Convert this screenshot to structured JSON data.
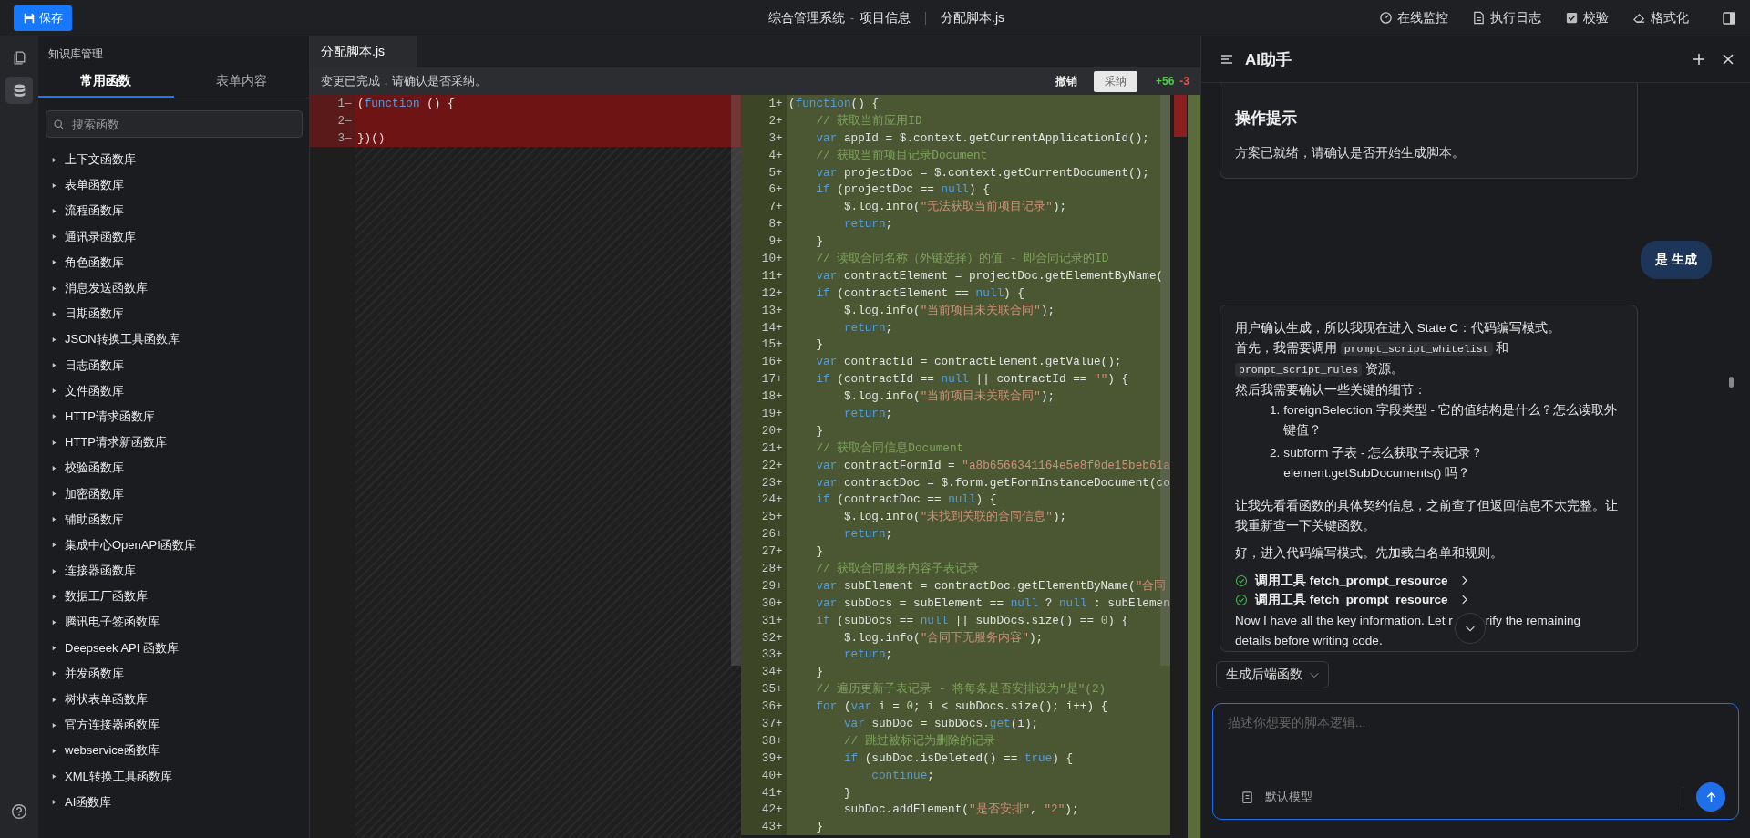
{
  "toolbar": {
    "save_button": "保存",
    "app": "综合管理系统",
    "separator": "-",
    "page": "项目信息",
    "file": "分配脚本.js",
    "actions": [
      {
        "label": "在线监控"
      },
      {
        "label": "执行日志"
      },
      {
        "label": "校验"
      },
      {
        "label": "格式化"
      }
    ]
  },
  "rail": [
    {
      "selected": false
    },
    {
      "selected": true
    }
  ],
  "sidebar": {
    "title": "知识库管理",
    "tabs": [
      {
        "label": "常用函数",
        "selected": true
      },
      {
        "label": "表单内容",
        "selected": false
      }
    ],
    "search": {
      "placeholder": "搜索函数"
    },
    "libraries": [
      {
        "label": "上下文函数库",
        "expanded": false
      },
      {
        "label": "表单函数库",
        "expanded": false
      },
      {
        "label": "流程函数库",
        "expanded": false
      },
      {
        "label": "通讯录函数库",
        "expanded": false
      },
      {
        "label": "角色函数库",
        "expanded": false
      },
      {
        "label": "消息发送函数库",
        "expanded": false
      },
      {
        "label": "日期函数库",
        "expanded": false
      },
      {
        "label": "JSON转换工具函数库",
        "expanded": false
      },
      {
        "label": "日志函数库",
        "expanded": false
      },
      {
        "label": "文件函数库",
        "expanded": false
      },
      {
        "label": "HTTP请求函数库",
        "expanded": false
      },
      {
        "label": "HTTP请求新函数库",
        "expanded": false
      },
      {
        "label": "校验函数库",
        "expanded": false
      },
      {
        "label": "加密函数库",
        "expanded": false
      },
      {
        "label": "辅助函数库",
        "expanded": false
      },
      {
        "label": "集成中心OpenAPI函数库",
        "expanded": false
      },
      {
        "label": "连接器函数库",
        "expanded": false
      },
      {
        "label": "数据工厂函数库",
        "expanded": false
      },
      {
        "label": "腾讯电子签函数库",
        "expanded": false
      },
      {
        "label": "Deepseek API 函数库",
        "expanded": false
      },
      {
        "label": "并发函数库",
        "expanded": false
      },
      {
        "label": "树状表单函数库",
        "expanded": false
      },
      {
        "label": "官方连接器函数库",
        "expanded": false
      },
      {
        "label": "webservice函数库",
        "expanded": false
      },
      {
        "label": "XML转换工具函数库",
        "expanded": false
      },
      {
        "label": "AI函数库",
        "expanded": false
      }
    ]
  },
  "editor": {
    "tabs": [
      {
        "label": "分配脚本.js",
        "selected": true
      }
    ],
    "notice": "变更已完成，请确认是否采纳。",
    "undo": "撤销",
    "accept": "采纳",
    "added": "+56",
    "removed": "-3",
    "panes": [
      {
        "kind": "removed",
        "lines": [
          {
            "num": "1",
            "sign": "—",
            "s": [
              {
                "kind": "plain",
                "text": "("
              },
              {
                "kind": "keyword",
                "text": "function"
              },
              {
                "kind": "plain",
                "text": " () {"
              }
            ]
          },
          {
            "num": "2",
            "sign": "—"
          },
          {
            "num": "3",
            "sign": "—",
            "s": [
              {
                "kind": "plain",
                "text": "})()"
              }
            ]
          }
        ]
      },
      {
        "kind": "added",
        "lines": [
          {
            "num": "1",
            "sign": "+",
            "s": [
              {
                "kind": "plain",
                "text": "("
              },
              {
                "kind": "keyword",
                "text": "function"
              },
              {
                "kind": "plain",
                "text": "() {"
              }
            ]
          },
          {
            "num": "2",
            "sign": "+",
            "s": [
              {
                "kind": "comment",
                "text": "    // 获取当前应用ID"
              }
            ]
          },
          {
            "num": "3",
            "sign": "+",
            "s": [
              {
                "kind": "keyword",
                "text": "    var"
              },
              {
                "kind": "plain",
                "text": " appId = $.context.getCurrentApplicationId();"
              }
            ]
          },
          {
            "num": "4",
            "sign": "+",
            "s": [
              {
                "kind": "comment",
                "text": "    // 获取当前项目记录Document"
              }
            ]
          },
          {
            "num": "5",
            "sign": "+",
            "s": [
              {
                "kind": "keyword",
                "text": "    var"
              },
              {
                "kind": "plain",
                "text": " projectDoc = $.context.getCurrentDocument();"
              }
            ]
          },
          {
            "num": "6",
            "sign": "+",
            "s": [
              {
                "kind": "keyword",
                "text": "    if"
              },
              {
                "kind": "plain",
                "text": " (projectDoc == "
              },
              {
                "kind": "keyword",
                "text": "null"
              },
              {
                "kind": "plain",
                "text": ") {"
              }
            ]
          },
          {
            "num": "7",
            "sign": "+",
            "s": [
              {
                "kind": "plain",
                "text": "        $.log.info("
              },
              {
                "kind": "string",
                "text": "\"无法获取当前项目记录\""
              },
              {
                "kind": "plain",
                "text": ");"
              }
            ]
          },
          {
            "num": "8",
            "sign": "+",
            "s": [
              {
                "kind": "keyword",
                "text": "        return"
              },
              {
                "kind": "plain",
                "text": ";"
              }
            ]
          },
          {
            "num": "9",
            "sign": "+",
            "s": [
              {
                "kind": "plain",
                "text": "    }"
              }
            ]
          },
          {
            "num": "10",
            "sign": "+",
            "s": [
              {
                "kind": "comment",
                "text": "    // 读取合同名称（外键选择）的值 - 即合同记录的ID"
              }
            ]
          },
          {
            "num": "11",
            "sign": "+",
            "s": [
              {
                "kind": "keyword",
                "text": "    var"
              },
              {
                "kind": "plain",
                "text": " contractElement = projectDoc.getElementByName("
              }
            ]
          },
          {
            "num": "12",
            "sign": "+",
            "s": [
              {
                "kind": "keyword",
                "text": "    if"
              },
              {
                "kind": "plain",
                "text": " (contractElement == "
              },
              {
                "kind": "keyword",
                "text": "null"
              },
              {
                "kind": "plain",
                "text": ") {"
              }
            ]
          },
          {
            "num": "13",
            "sign": "+",
            "s": [
              {
                "kind": "plain",
                "text": "        $.log.info("
              },
              {
                "kind": "string",
                "text": "\"当前项目未关联合同\""
              },
              {
                "kind": "plain",
                "text": ");"
              }
            ]
          },
          {
            "num": "14",
            "sign": "+",
            "s": [
              {
                "kind": "keyword",
                "text": "        return"
              },
              {
                "kind": "plain",
                "text": ";"
              }
            ]
          },
          {
            "num": "15",
            "sign": "+",
            "s": [
              {
                "kind": "plain",
                "text": "    }"
              }
            ]
          },
          {
            "num": "16",
            "sign": "+",
            "s": [
              {
                "kind": "keyword",
                "text": "    var"
              },
              {
                "kind": "plain",
                "text": " contractId = contractElement.getValue();"
              }
            ]
          },
          {
            "num": "17",
            "sign": "+",
            "s": [
              {
                "kind": "keyword",
                "text": "    if"
              },
              {
                "kind": "plain",
                "text": " (contractId == "
              },
              {
                "kind": "keyword",
                "text": "null"
              },
              {
                "kind": "plain",
                "text": " || contractId == "
              },
              {
                "kind": "string",
                "text": "\"\""
              },
              {
                "kind": "plain",
                "text": ") {"
              }
            ]
          },
          {
            "num": "18",
            "sign": "+",
            "s": [
              {
                "kind": "plain",
                "text": "        $.log.info("
              },
              {
                "kind": "string",
                "text": "\"当前项目未关联合同\""
              },
              {
                "kind": "plain",
                "text": ");"
              }
            ]
          },
          {
            "num": "19",
            "sign": "+",
            "s": [
              {
                "kind": "keyword",
                "text": "        return"
              },
              {
                "kind": "plain",
                "text": ";"
              }
            ]
          },
          {
            "num": "20",
            "sign": "+",
            "s": [
              {
                "kind": "plain",
                "text": "    }"
              }
            ]
          },
          {
            "num": "21",
            "sign": "+",
            "s": [
              {
                "kind": "comment",
                "text": "    // 获取合同信息Document"
              }
            ]
          },
          {
            "num": "22",
            "sign": "+",
            "s": [
              {
                "kind": "keyword",
                "text": "    var"
              },
              {
                "kind": "plain",
                "text": " contractFormId = "
              },
              {
                "kind": "string",
                "text": "\"a8b6566341164e5e8f0de15beb61a"
              }
            ]
          },
          {
            "num": "23",
            "sign": "+",
            "s": [
              {
                "kind": "keyword",
                "text": "    var"
              },
              {
                "kind": "plain",
                "text": " contractDoc = $.form.getFormInstanceDocument(co"
              }
            ]
          },
          {
            "num": "24",
            "sign": "+",
            "s": [
              {
                "kind": "keyword",
                "text": "    if"
              },
              {
                "kind": "plain",
                "text": " (contractDoc == "
              },
              {
                "kind": "keyword",
                "text": "null"
              },
              {
                "kind": "plain",
                "text": ") {"
              }
            ]
          },
          {
            "num": "25",
            "sign": "+",
            "s": [
              {
                "kind": "plain",
                "text": "        $.log.info("
              },
              {
                "kind": "string",
                "text": "\"未找到关联的合同信息\""
              },
              {
                "kind": "plain",
                "text": ");"
              }
            ]
          },
          {
            "num": "26",
            "sign": "+",
            "s": [
              {
                "kind": "keyword",
                "text": "        return"
              },
              {
                "kind": "plain",
                "text": ";"
              }
            ]
          },
          {
            "num": "27",
            "sign": "+",
            "s": [
              {
                "kind": "plain",
                "text": "    }"
              }
            ]
          },
          {
            "num": "28",
            "sign": "+",
            "s": [
              {
                "kind": "comment",
                "text": "    // 获取合同服务内容子表记录"
              }
            ]
          },
          {
            "num": "29",
            "sign": "+",
            "s": [
              {
                "kind": "keyword",
                "text": "    var"
              },
              {
                "kind": "plain",
                "text": " subElement = contractDoc.getElementByName("
              },
              {
                "kind": "string",
                "text": "\"合同"
              }
            ]
          },
          {
            "num": "30",
            "sign": "+",
            "s": [
              {
                "kind": "keyword",
                "text": "    var"
              },
              {
                "kind": "plain",
                "text": " subDocs = subElement == "
              },
              {
                "kind": "keyword",
                "text": "null"
              },
              {
                "kind": "plain",
                "text": " ? "
              },
              {
                "kind": "keyword",
                "text": "null"
              },
              {
                "kind": "plain",
                "text": " : subElemen"
              }
            ]
          },
          {
            "num": "31",
            "sign": "+",
            "s": [
              {
                "kind": "keyword",
                "text": "    if"
              },
              {
                "kind": "plain",
                "text": " (subDocs == "
              },
              {
                "kind": "keyword",
                "text": "null"
              },
              {
                "kind": "plain",
                "text": " || subDocs.size() == "
              },
              {
                "kind": "number",
                "text": "0"
              },
              {
                "kind": "plain",
                "text": ") {"
              }
            ]
          },
          {
            "num": "32",
            "sign": "+",
            "s": [
              {
                "kind": "plain",
                "text": "        $.log.info("
              },
              {
                "kind": "string",
                "text": "\"合同下无服务内容\""
              },
              {
                "kind": "plain",
                "text": ");"
              }
            ]
          },
          {
            "num": "33",
            "sign": "+",
            "s": [
              {
                "kind": "keyword",
                "text": "        return"
              },
              {
                "kind": "plain",
                "text": ";"
              }
            ]
          },
          {
            "num": "34",
            "sign": "+",
            "s": [
              {
                "kind": "plain",
                "text": "    }"
              }
            ]
          },
          {
            "num": "35",
            "sign": "+",
            "s": [
              {
                "kind": "comment",
                "text": "    // 遍历更新子表记录 - 将每条是否安排设为\"是\"(2)"
              }
            ]
          },
          {
            "num": "36",
            "sign": "+",
            "s": [
              {
                "kind": "keyword",
                "text": "    for"
              },
              {
                "kind": "plain",
                "text": " ("
              },
              {
                "kind": "keyword",
                "text": "var"
              },
              {
                "kind": "plain",
                "text": " i = "
              },
              {
                "kind": "number",
                "text": "0"
              },
              {
                "kind": "plain",
                "text": "; i < subDocs.size(); i++) {"
              }
            ]
          },
          {
            "num": "37",
            "sign": "+",
            "s": [
              {
                "kind": "keyword",
                "text": "        var"
              },
              {
                "kind": "plain",
                "text": " subDoc = subDocs."
              },
              {
                "kind": "keyword",
                "text": "get"
              },
              {
                "kind": "plain",
                "text": "(i);"
              }
            ]
          },
          {
            "num": "38",
            "sign": "+",
            "s": [
              {
                "kind": "comment",
                "text": "        // 跳过被标记为删除的记录"
              }
            ]
          },
          {
            "num": "39",
            "sign": "+",
            "s": [
              {
                "kind": "keyword",
                "text": "        if"
              },
              {
                "kind": "plain",
                "text": " (subDoc.isDeleted() == "
              },
              {
                "kind": "keyword",
                "text": "true"
              },
              {
                "kind": "plain",
                "text": ") {"
              }
            ]
          },
          {
            "num": "40",
            "sign": "+",
            "s": [
              {
                "kind": "keyword",
                "text": "            continue"
              },
              {
                "kind": "plain",
                "text": ";"
              }
            ]
          },
          {
            "num": "41",
            "sign": "+",
            "s": [
              {
                "kind": "plain",
                "text": "        }"
              }
            ]
          },
          {
            "num": "42",
            "sign": "+",
            "s": [
              {
                "kind": "plain",
                "text": "        subDoc.addElement("
              },
              {
                "kind": "string",
                "text": "\"是否安排\""
              },
              {
                "kind": "plain",
                "text": ", "
              },
              {
                "kind": "string",
                "text": "\"2\""
              },
              {
                "kind": "plain",
                "text": ");"
              }
            ]
          },
          {
            "num": "43",
            "sign": "+",
            "s": [
              {
                "kind": "plain",
                "text": "    }"
              }
            ]
          }
        ]
      }
    ]
  },
  "assistant": {
    "title": "AI助手",
    "messages": [
      {
        "kind": "notice",
        "title": "操作提示",
        "text": "方案已就绪，请确认是否开始生成脚本。"
      },
      {
        "kind": "user",
        "text": "是 生成"
      },
      {
        "kind": "assistant",
        "blocks": [
          {
            "kind": "para",
            "parts": [
              {
                "kind": "text",
                "text": "用户确认生成，所以我现在进入 State C：代码编写模式。"
              }
            ]
          },
          {
            "kind": "para",
            "parts": [
              {
                "kind": "text",
                "text": "首先，我需要调用 "
              },
              {
                "kind": "code",
                "text": "prompt_script_whitelist"
              },
              {
                "kind": "text",
                "text": " 和 "
              },
              {
                "kind": "code",
                "text": "prompt_script_rules"
              },
              {
                "kind": "text",
                "text": " 资源。"
              }
            ]
          },
          {
            "kind": "para",
            "parts": [
              {
                "kind": "text",
                "text": "然后我需要确认一些关键的细节："
              }
            ]
          },
          {
            "kind": "list",
            "items": [
              {
                "marker": "1.",
                "text": "foreignSelection 字段类型 - 它的值结构是什么？怎么读取外键值？"
              },
              {
                "marker": "2.",
                "text": "subform 子表 - 怎么获取子表记录？element.getSubDocuments() 吗？"
              }
            ]
          },
          {
            "kind": "para",
            "parts": [
              {
                "kind": "text",
                "text": "让我先看看函数的具体契约信息，之前查了但返回信息不太完整。让我重新查一下关键函数。"
              }
            ]
          },
          {
            "kind": "para",
            "parts": [
              {
                "kind": "text",
                "text": "好，进入代码编写模式。先加载白名单和规则。"
              }
            ]
          },
          {
            "kind": "tool",
            "label": "调用工具 fetch_prompt_resource",
            "done": true
          },
          {
            "kind": "tool",
            "label": "调用工具 fetch_prompt_resource",
            "done": true
          },
          {
            "kind": "covered",
            "before": "Now I have all the key information. Let r",
            "after": "rify the remaining",
            "next": "details before writing code."
          }
        ]
      }
    ],
    "mode_select": "生成后端函数",
    "input": {
      "placeholder": "描述你想要的脚本逻辑..."
    },
    "model": "默认模型"
  }
}
